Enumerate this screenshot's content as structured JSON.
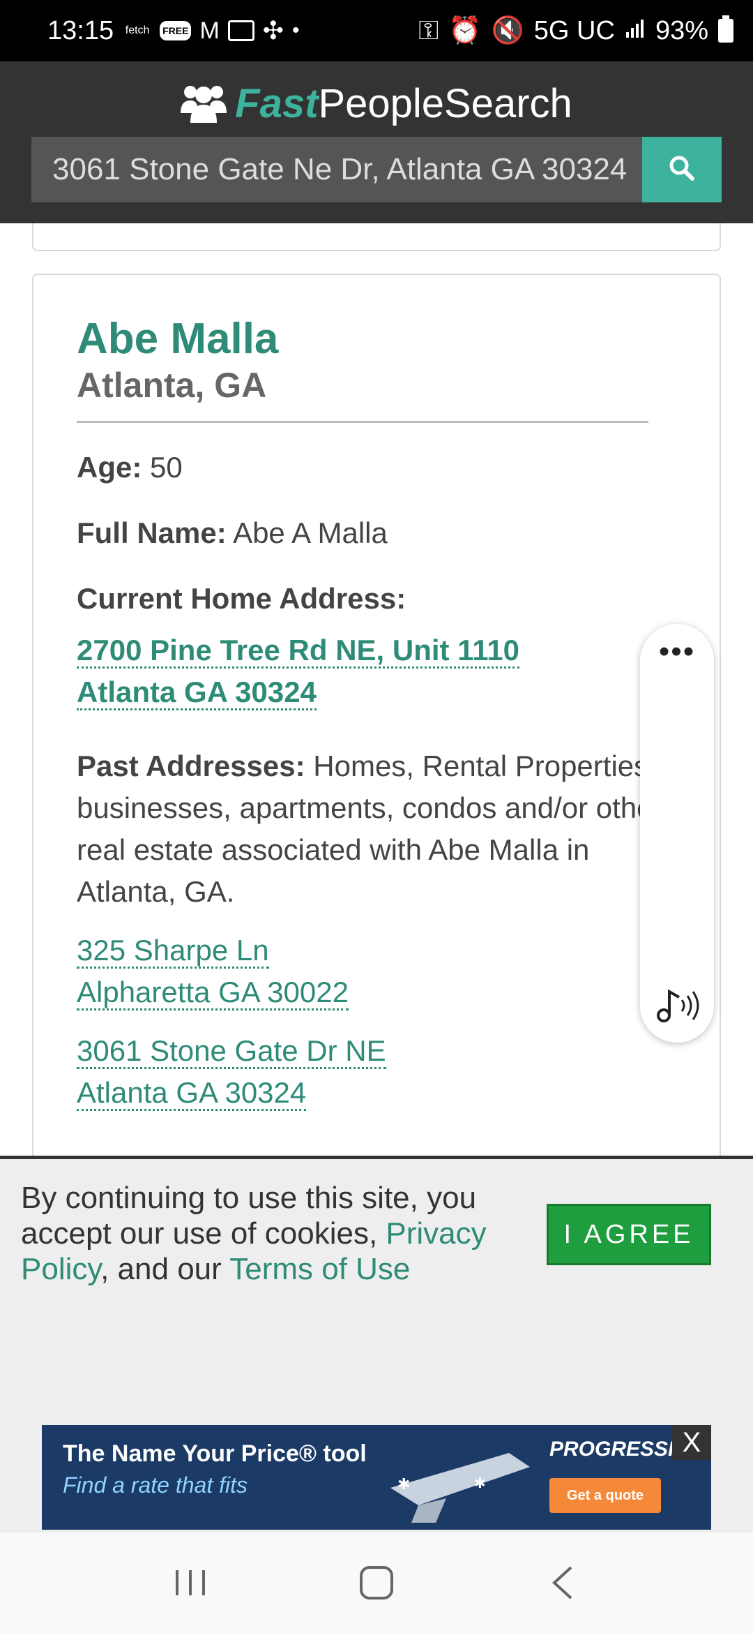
{
  "status_bar": {
    "time": "13:15",
    "fetch_label": "fetch",
    "free_label": "FREE",
    "network": "5G UC",
    "battery": "93%"
  },
  "header": {
    "logo_fast": "Fast",
    "logo_rest": "PeopleSearch",
    "search_value": "3061 Stone Gate Ne Dr, Atlanta GA 30324"
  },
  "person": {
    "name": "Abe Malla",
    "location": "Atlanta, GA",
    "age_label": "Age:",
    "age": "50",
    "fullname_label": "Full Name:",
    "fullname": "Abe A Malla",
    "current_label": "Current Home Address:",
    "current_line1": "2700 Pine Tree Rd NE, Unit 1110",
    "current_line2": "Atlanta GA 30324",
    "past_label": "Past Addresses:",
    "past_desc": "Homes, Rental Properties, businesses, apartments, condos and/or other real estate associated with Abe Malla in Atlanta, GA.",
    "past_addresses": [
      {
        "line1": "325 Sharpe Ln",
        "line2": "Alpharetta GA 30022"
      },
      {
        "line1": "3061 Stone Gate Dr NE",
        "line2": "Atlanta GA 30324"
      }
    ]
  },
  "float_widget": {
    "more_label": "•••"
  },
  "cookie": {
    "text_before": "By continuing to use this site, you accept our use of cookies, ",
    "privacy_link": "Privacy Policy",
    "text_mid": ", and our ",
    "terms_link": "Terms of Use",
    "agree_label": "I AGREE"
  },
  "ad": {
    "line1": "The Name Your Price® tool",
    "line2": "Find a rate that fits",
    "brand": "PROGRESSIVE",
    "cta": "Get a quote",
    "close": "X"
  },
  "colors": {
    "accent": "#3db39e",
    "link": "#2e8b77",
    "header_bg": "#333333",
    "agree": "#1e9e3e"
  }
}
